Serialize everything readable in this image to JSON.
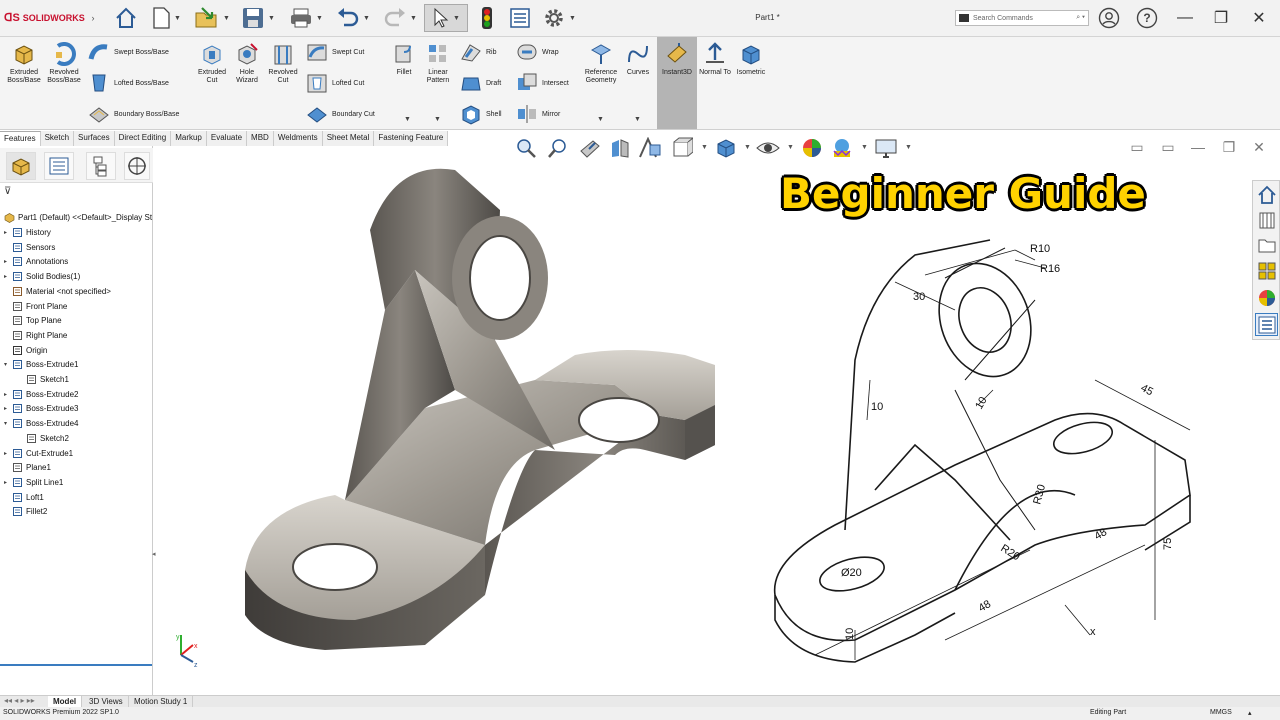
{
  "app": {
    "brand": "SOLIDWORKS",
    "window_title": "Part1 *"
  },
  "search": {
    "placeholder": "Search Commands"
  },
  "ribbon": {
    "extruded_boss": "Extruded Boss/Base",
    "revolved_boss": "Revolved Boss/Base",
    "swept_boss": "Swept Boss/Base",
    "lofted_boss": "Lofted Boss/Base",
    "boundary_boss": "Boundary Boss/Base",
    "extruded_cut": "Extruded Cut",
    "hole_wizard": "Hole Wizard",
    "revolved_cut": "Revolved Cut",
    "swept_cut": "Swept Cut",
    "lofted_cut": "Lofted Cut",
    "boundary_cut": "Boundary Cut",
    "fillet": "Fillet",
    "linear_pattern": "Linear Pattern",
    "rib": "Rib",
    "draft": "Draft",
    "shell": "Shell",
    "wrap": "Wrap",
    "intersect": "Intersect",
    "mirror": "Mirror",
    "reference_geometry": "Reference Geometry",
    "curves": "Curves",
    "instant3d": "Instant3D",
    "normal_to": "Normal To",
    "isometric": "Isometric"
  },
  "tabs": [
    "Features",
    "Sketch",
    "Surfaces",
    "Direct Editing",
    "Markup",
    "Evaluate",
    "MBD",
    "Weldments",
    "Sheet Metal",
    "Fastening Feature"
  ],
  "tree": {
    "root": "Part1 (Default) <<Default>_Display St",
    "items": [
      {
        "label": "History",
        "arrow": "▸",
        "icon": "history-icon"
      },
      {
        "label": "Sensors",
        "arrow": "",
        "icon": "sensors-icon"
      },
      {
        "label": "Annotations",
        "arrow": "▸",
        "icon": "annotations-icon"
      },
      {
        "label": "Solid Bodies(1)",
        "arrow": "▸",
        "icon": "solid-bodies-icon"
      },
      {
        "label": "Material <not specified>",
        "arrow": "",
        "icon": "material-icon"
      },
      {
        "label": "Front Plane",
        "arrow": "",
        "icon": "plane-icon"
      },
      {
        "label": "Top Plane",
        "arrow": "",
        "icon": "plane-icon"
      },
      {
        "label": "Right Plane",
        "arrow": "",
        "icon": "plane-icon"
      },
      {
        "label": "Origin",
        "arrow": "",
        "icon": "origin-icon"
      },
      {
        "label": "Boss-Extrude1",
        "arrow": "▾",
        "icon": "extrude-icon"
      },
      {
        "label": "Sketch1",
        "arrow": "",
        "icon": "sketch-icon",
        "indent": true
      },
      {
        "label": "Boss-Extrude2",
        "arrow": "▸",
        "icon": "extrude-icon"
      },
      {
        "label": "Boss-Extrude3",
        "arrow": "▸",
        "icon": "extrude-icon"
      },
      {
        "label": "Boss-Extrude4",
        "arrow": "▾",
        "icon": "extrude-icon"
      },
      {
        "label": "Sketch2",
        "arrow": "",
        "icon": "sketch-icon",
        "indent": true
      },
      {
        "label": "Cut-Extrude1",
        "arrow": "▸",
        "icon": "cut-extrude-icon"
      },
      {
        "label": "Plane1",
        "arrow": "",
        "icon": "plane-icon"
      },
      {
        "label": "Split Line1",
        "arrow": "▸",
        "icon": "split-line-icon"
      },
      {
        "label": "Loft1",
        "arrow": "",
        "icon": "loft-icon"
      },
      {
        "label": "Fillet2",
        "arrow": "",
        "icon": "fillet-icon"
      }
    ]
  },
  "overlay": {
    "headline": "Beginner Guide"
  },
  "drawing": {
    "r10": "R10",
    "r16": "R16",
    "d30": "30",
    "d10a": "10",
    "d10b": "10",
    "d45": "45",
    "r30": "R30",
    "r20": "R20",
    "d48a": "48",
    "d48b": "48",
    "d75": "75",
    "phi20": "Ø20",
    "d10c": "10",
    "x": "x"
  },
  "triad": {
    "x": "x",
    "y": "y",
    "z": "z"
  },
  "bottom_tabs": [
    "Model",
    "3D Views",
    "Motion Study 1"
  ],
  "status": {
    "product": "SOLIDWORKS Premium 2022 SP1.0",
    "mode": "Editing Part",
    "units": "MMGS"
  },
  "colors": {
    "accent": "#3a7cc0",
    "headline": "#ffd200",
    "brand": "#c8102e",
    "metal": "#8f8a82"
  }
}
